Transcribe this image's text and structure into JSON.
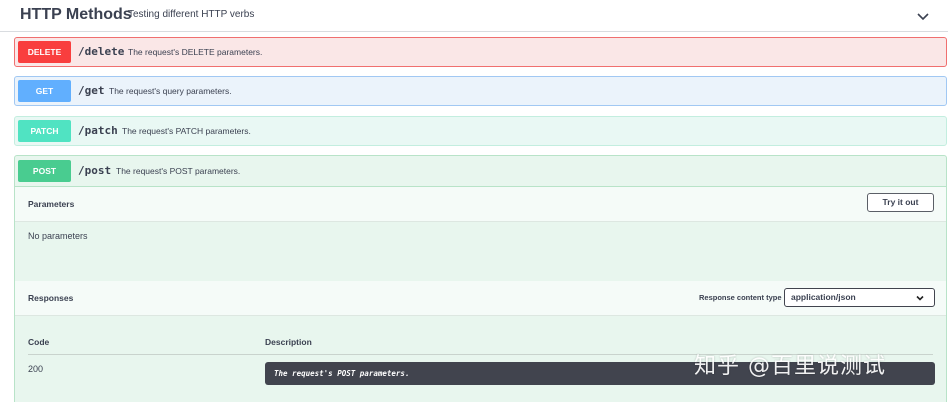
{
  "tag": {
    "title": "HTTP Methods",
    "description": "Testing different HTTP verbs",
    "chevron_icon": "chevron-down-icon"
  },
  "operations": [
    {
      "method": "DELETE",
      "path": "/delete",
      "summary": "The request's DELETE parameters.",
      "color": "#f93e3e"
    },
    {
      "method": "GET",
      "path": "/get",
      "summary": "The request's query parameters.",
      "color": "#61affe"
    },
    {
      "method": "PATCH",
      "path": "/patch",
      "summary": "The request's PATCH parameters.",
      "color": "#50e3c2"
    },
    {
      "method": "POST",
      "path": "/post",
      "summary": "The request's POST parameters.",
      "color": "#49cc90"
    }
  ],
  "post_detail": {
    "parameters_title": "Parameters",
    "try_it_out_label": "Try it out",
    "no_parameters_text": "No parameters",
    "responses_title": "Responses",
    "response_content_type_label": "Response content type",
    "response_content_type_value": "application/json",
    "code_header": "Code",
    "description_header": "Description",
    "response_code": "200",
    "response_description": "The request's POST parameters."
  },
  "watermark": "知乎 @百里说测试"
}
